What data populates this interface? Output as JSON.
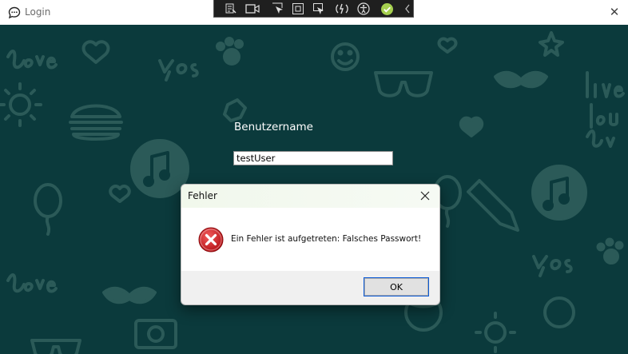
{
  "window": {
    "title": "Login",
    "close_glyph": "✕"
  },
  "debug_toolbar": {
    "icons": [
      "live-visual-tree-icon",
      "record-icon",
      "select-element-icon",
      "display-layout-adorners-icon",
      "track-focus-icon",
      "hot-reload-icon",
      "accessibility-icon",
      "xaml-binding-ok-icon",
      "collapse-chevron-icon"
    ]
  },
  "form": {
    "username_label": "Benutzername",
    "username_value": "testUser"
  },
  "dialog": {
    "title": "Fehler",
    "close_glyph": "✕",
    "message": "Ein Fehler ist aufgetreten: Falsches Passwort!",
    "ok_label": "OK",
    "icon": "error-icon"
  },
  "colors": {
    "background": "#0b3a3c",
    "doodle": "#2b5a58",
    "error_red": "#c8151b",
    "focus_blue": "#0a5ad7"
  }
}
